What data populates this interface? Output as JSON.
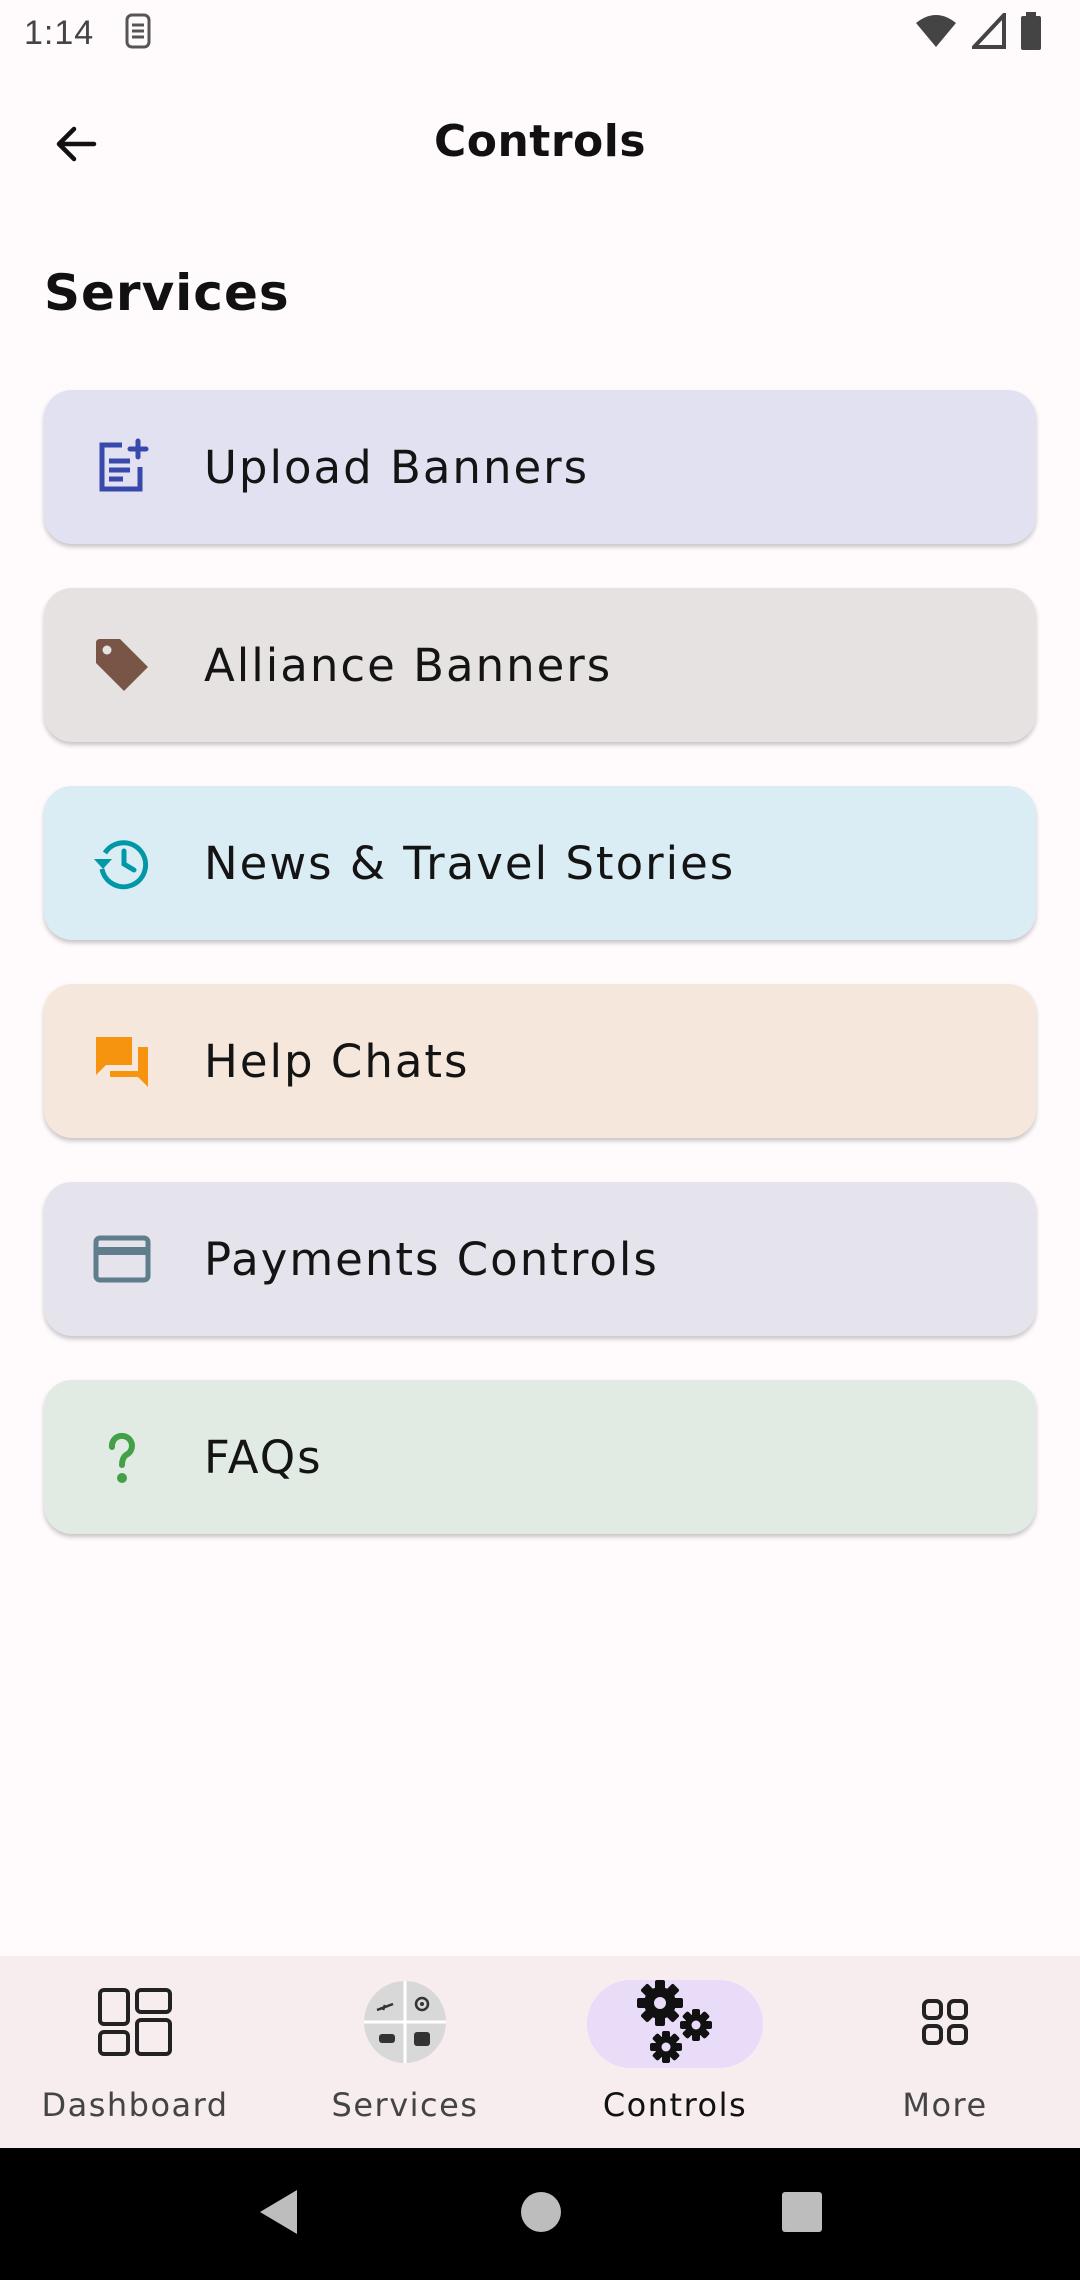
{
  "status_bar": {
    "time": "1:14",
    "icons": [
      "sim-card-icon",
      "wifi-icon",
      "signal-icon",
      "battery-icon"
    ]
  },
  "app_bar": {
    "title": "Controls",
    "back_icon": "arrow-back-icon"
  },
  "section_title": "Services",
  "tiles": [
    {
      "label": "Upload Banners",
      "icon": "post-add-icon",
      "bg": "#e1e1f1",
      "icon_color": "#3949ab"
    },
    {
      "label": "Alliance Banners",
      "icon": "tag-icon",
      "bg": "#e7e2e2",
      "icon_color": "#795548"
    },
    {
      "label": "News & Travel Stories",
      "icon": "history-icon",
      "bg": "#daecf4",
      "icon_color": "#0097a7"
    },
    {
      "label": "Help Chats",
      "icon": "forum-icon",
      "bg": "#f5e7db",
      "icon_color": "#f7940f"
    },
    {
      "label": "Payments Controls",
      "icon": "credit-card-icon",
      "bg": "#e5e4ec",
      "icon_color": "#607d8b"
    },
    {
      "label": "FAQs",
      "icon": "question-mark-icon",
      "bg": "#e1ebe3",
      "icon_color": "#43a047"
    }
  ],
  "bottom_nav": {
    "items": [
      {
        "label": "Dashboard",
        "icon": "dashboard-icon",
        "active": false
      },
      {
        "label": "Services",
        "icon": "services-icon",
        "active": false
      },
      {
        "label": "Controls",
        "icon": "gears-icon",
        "active": true
      },
      {
        "label": "More",
        "icon": "grid-icon",
        "active": false
      }
    ],
    "active_bg": "#e8dcf8"
  },
  "system_nav": {
    "icons": [
      "back-triangle-icon",
      "home-circle-icon",
      "recents-square-icon"
    ]
  }
}
